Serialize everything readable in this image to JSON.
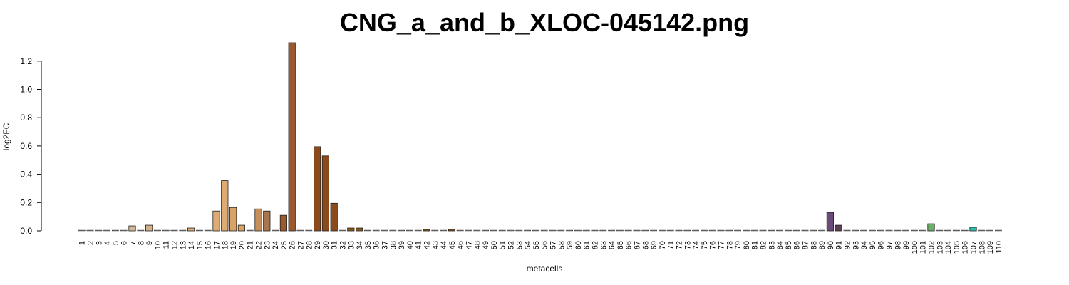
{
  "chart_data": {
    "type": "bar",
    "title": "CNG_a_and_b_XLOC-045142.png",
    "xlabel": "metacells",
    "ylabel": "log2FC",
    "ylim": [
      0,
      1.3
    ],
    "yticks": [
      "0.0",
      "0.2",
      "0.4",
      "0.6",
      "0.8",
      "1.0",
      "1.2"
    ],
    "grid": false,
    "categories": [
      "1",
      "2",
      "3",
      "4",
      "5",
      "6",
      "7",
      "8",
      "9",
      "10",
      "11",
      "12",
      "13",
      "14",
      "15",
      "16",
      "17",
      "18",
      "19",
      "20",
      "21",
      "22",
      "23",
      "24",
      "25",
      "26",
      "27",
      "28",
      "29",
      "30",
      "31",
      "32",
      "33",
      "34",
      "35",
      "36",
      "37",
      "38",
      "39",
      "40",
      "41",
      "42",
      "43",
      "44",
      "45",
      "46",
      "47",
      "48",
      "49",
      "50",
      "51",
      "52",
      "53",
      "54",
      "55",
      "56",
      "57",
      "58",
      "59",
      "60",
      "61",
      "62",
      "63",
      "64",
      "65",
      "66",
      "67",
      "68",
      "69",
      "70",
      "71",
      "72",
      "73",
      "74",
      "75",
      "76",
      "77",
      "78",
      "79",
      "80",
      "81",
      "82",
      "83",
      "84",
      "85",
      "86",
      "87",
      "88",
      "89",
      "90",
      "91",
      "92",
      "93",
      "94",
      "95",
      "96",
      "97",
      "98",
      "99",
      "100",
      "101",
      "102",
      "103",
      "104",
      "105",
      "106",
      "107",
      "108",
      "109",
      "110"
    ],
    "values": [
      0,
      0,
      0,
      0,
      0,
      0,
      0.035,
      0,
      0.04,
      0,
      0,
      0,
      0,
      0.02,
      0,
      0,
      0.14,
      0.355,
      0.165,
      0.04,
      0,
      0.155,
      0.14,
      0,
      0.11,
      1.33,
      0,
      0,
      0.595,
      0.53,
      0.195,
      0,
      0.02,
      0.02,
      0,
      0,
      0,
      0,
      0,
      0,
      0,
      0.01,
      0,
      0,
      0.01,
      0,
      0,
      0,
      0,
      0,
      0,
      0,
      0,
      0,
      0,
      0,
      0,
      0,
      0,
      0,
      0,
      0,
      0,
      0,
      0,
      0,
      0,
      0,
      0,
      0,
      0,
      0,
      0,
      0,
      0,
      0,
      0,
      0,
      0,
      0,
      0,
      0,
      0,
      0,
      0,
      0,
      0,
      0,
      0,
      0.13,
      0.04,
      0,
      0,
      0,
      0,
      0,
      0,
      0,
      0,
      0,
      0,
      0.05,
      0,
      0,
      0,
      0,
      0.025,
      0,
      0,
      0
    ],
    "colors": [
      "#d3c0a6",
      "#d3c0a6",
      "#d3c0a6",
      "#d3c0a6",
      "#d3c0a6",
      "#d3c0a6",
      "#d3b798",
      "#d3b798",
      "#d6b08a",
      "#d6b08a",
      "#d6b08a",
      "#d6b08a",
      "#deae7c",
      "#deae7c",
      "#deae7c",
      "#e0ab72",
      "#e0ab72",
      "#e0ab72",
      "#d9a367",
      "#d9a367",
      "#c98f5a",
      "#c98f5a",
      "#a8764a",
      "#a8764a",
      "#9a5a2c",
      "#9a5a2c",
      "#8b4a1c",
      "#8b4a1c",
      "#8b4a1c",
      "#8b4a1c",
      "#8b4a1c",
      "#8b4a1c",
      "#8b5a1c",
      "#8b5a1c",
      "#8b5a1c",
      "#8b5a1c",
      "#8b5a1c",
      "#8b5a1c",
      "#8b5a1c",
      "#8b5a1c",
      "#8b5a1c",
      "#8b5a1c",
      "#8b5a1c",
      "#8b5a1c",
      "#8b5a1c",
      "#8b5a1c",
      "#8b5a1c",
      "#8b5a1c",
      "#8b5a1c",
      "#8b5a1c",
      "#8b5a1c",
      "#8b5a1c",
      "#8b5a1c",
      "#8b5a1c",
      "#8b5a1c",
      "#8b5a1c",
      "#8b5a1c",
      "#8b5a1c",
      "#8b5a1c",
      "#8b5a1c",
      "#8b5a1c",
      "#8b5a1c",
      "#8b5a1c",
      "#8b5a1c",
      "#8b5a1c",
      "#8b5a1c",
      "#8b5a1c",
      "#8b5a1c",
      "#8b5a1c",
      "#8b5a1c",
      "#8b5a1c",
      "#8b5a1c",
      "#8b5a1c",
      "#8b5a1c",
      "#8b5a1c",
      "#8b5a1c",
      "#8b5a1c",
      "#8b5a1c",
      "#8b5a1c",
      "#8b5a1c",
      "#8b5a1c",
      "#8b5a1c",
      "#8b5a1c",
      "#8b5a1c",
      "#8b5a1c",
      "#8b5a1c",
      "#8b5a1c",
      "#8b5a1c",
      "#8b5a1c",
      "#6a4a7a",
      "#5a4050",
      "#5a4050",
      "#5a4050",
      "#5a4050",
      "#5a4050",
      "#5a4050",
      "#5a4050",
      "#5a4050",
      "#5a4050",
      "#5a4050",
      "#5a4050",
      "#6ab06a",
      "#6ab06a",
      "#6ab06a",
      "#6ab06a",
      "#6ab06a",
      "#30c0a8",
      "#30c0a8",
      "#30c0a8",
      "#30c0a8"
    ]
  }
}
